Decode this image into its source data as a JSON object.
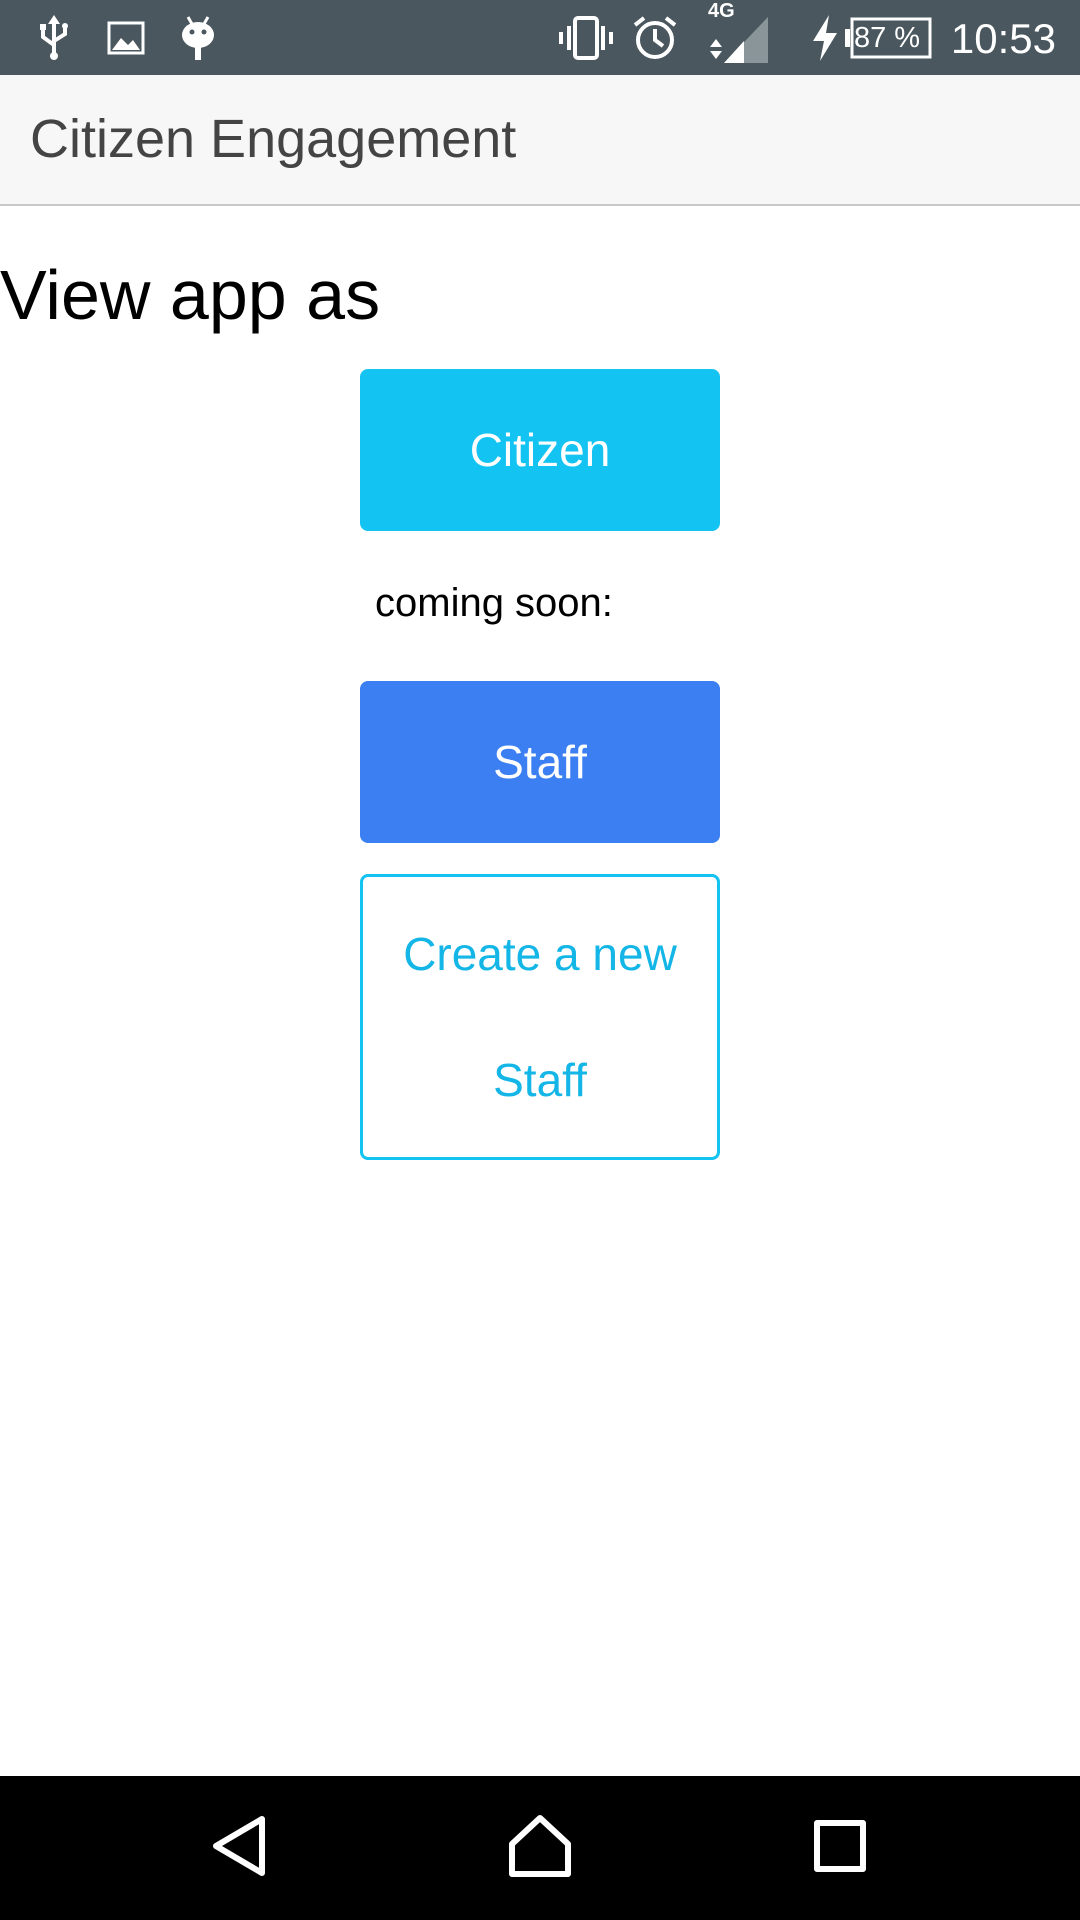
{
  "status_bar": {
    "network": "4G",
    "battery": "87 %",
    "time": "10:53",
    "icons": [
      "usb-icon",
      "image-icon",
      "android-icon",
      "vibrate-icon",
      "alarm-icon",
      "signal-icon",
      "charging-icon",
      "battery-icon"
    ]
  },
  "app_bar": {
    "title": "Citizen Engagement"
  },
  "main": {
    "heading": "View app as",
    "citizen_button": "Citizen",
    "coming_soon": "coming soon:",
    "staff_button": "Staff",
    "create_staff_button": "Create a new Staff"
  },
  "nav_bar": {
    "icons": [
      "back-icon",
      "home-icon",
      "recents-icon"
    ]
  },
  "colors": {
    "status_bar": "#4a575e",
    "citizen_button": "#13c3f2",
    "staff_button": "#3b7ff2",
    "create_border": "#13c3f2"
  }
}
